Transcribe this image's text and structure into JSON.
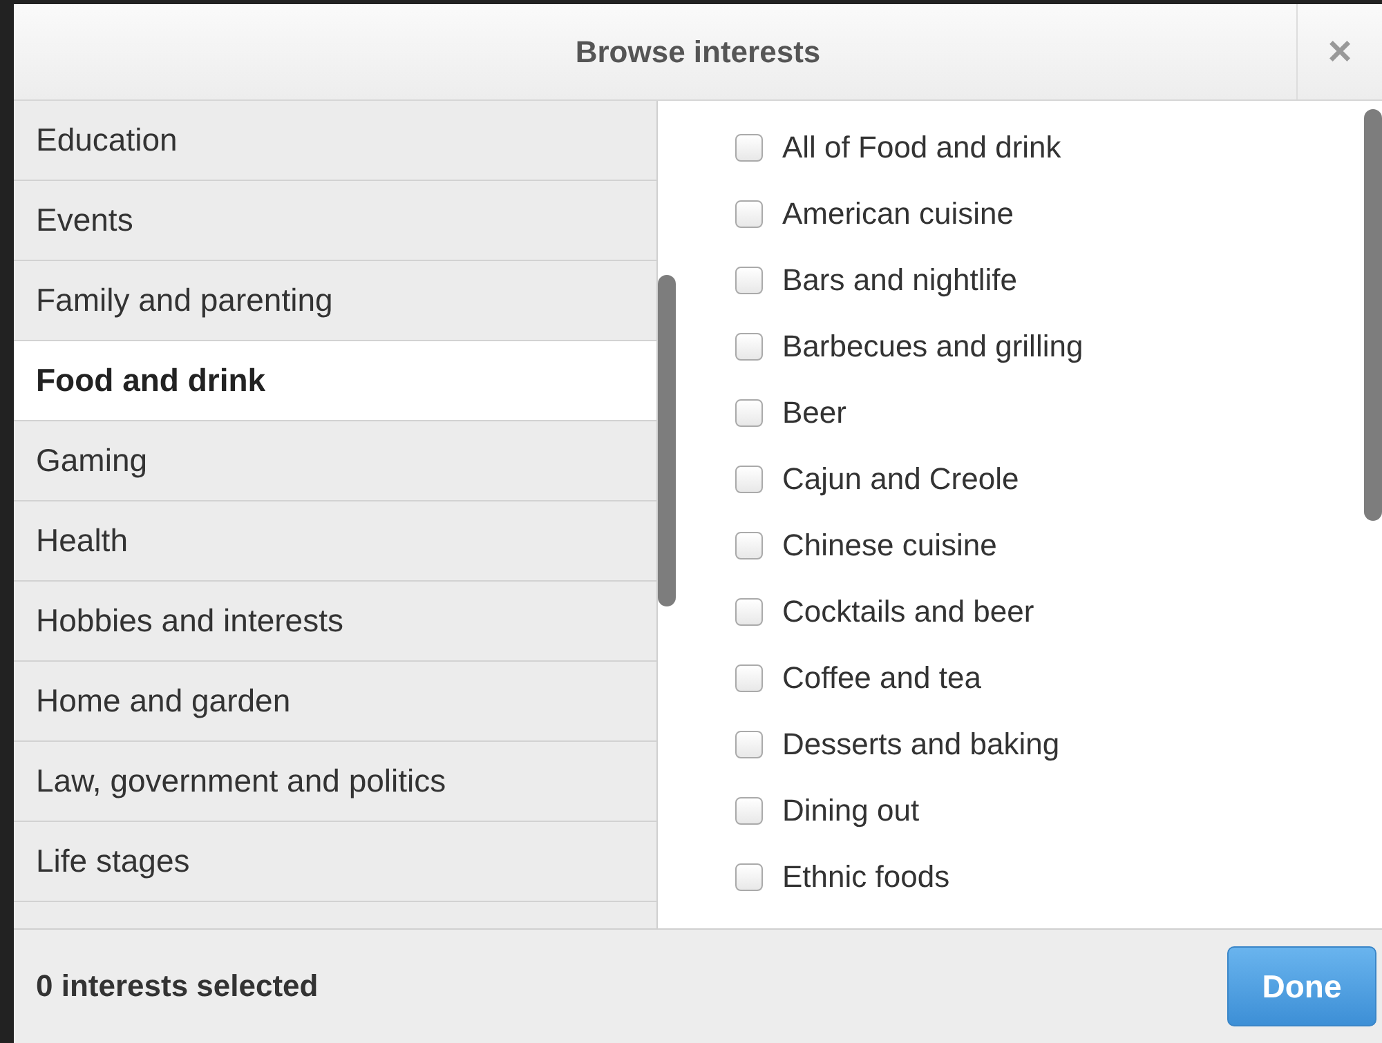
{
  "dialog": {
    "title": "Browse interests",
    "close": "×"
  },
  "categories": [
    {
      "label": "Education",
      "selected": false
    },
    {
      "label": "Events",
      "selected": false
    },
    {
      "label": "Family and parenting",
      "selected": false
    },
    {
      "label": "Food and drink",
      "selected": true
    },
    {
      "label": "Gaming",
      "selected": false
    },
    {
      "label": "Health",
      "selected": false
    },
    {
      "label": "Hobbies and interests",
      "selected": false
    },
    {
      "label": "Home and garden",
      "selected": false
    },
    {
      "label": "Law, government and politics",
      "selected": false
    },
    {
      "label": "Life stages",
      "selected": false
    }
  ],
  "interests": [
    {
      "label": "All of Food and drink",
      "checked": false
    },
    {
      "label": "American cuisine",
      "checked": false
    },
    {
      "label": "Bars and nightlife",
      "checked": false
    },
    {
      "label": "Barbecues and grilling",
      "checked": false
    },
    {
      "label": "Beer",
      "checked": false
    },
    {
      "label": "Cajun and Creole",
      "checked": false
    },
    {
      "label": "Chinese cuisine",
      "checked": false
    },
    {
      "label": "Cocktails and beer",
      "checked": false
    },
    {
      "label": "Coffee and tea",
      "checked": false
    },
    {
      "label": "Desserts and baking",
      "checked": false
    },
    {
      "label": "Dining out",
      "checked": false
    },
    {
      "label": "Ethnic foods",
      "checked": false
    }
  ],
  "footer": {
    "status": "0 interests selected",
    "done": "Done"
  }
}
